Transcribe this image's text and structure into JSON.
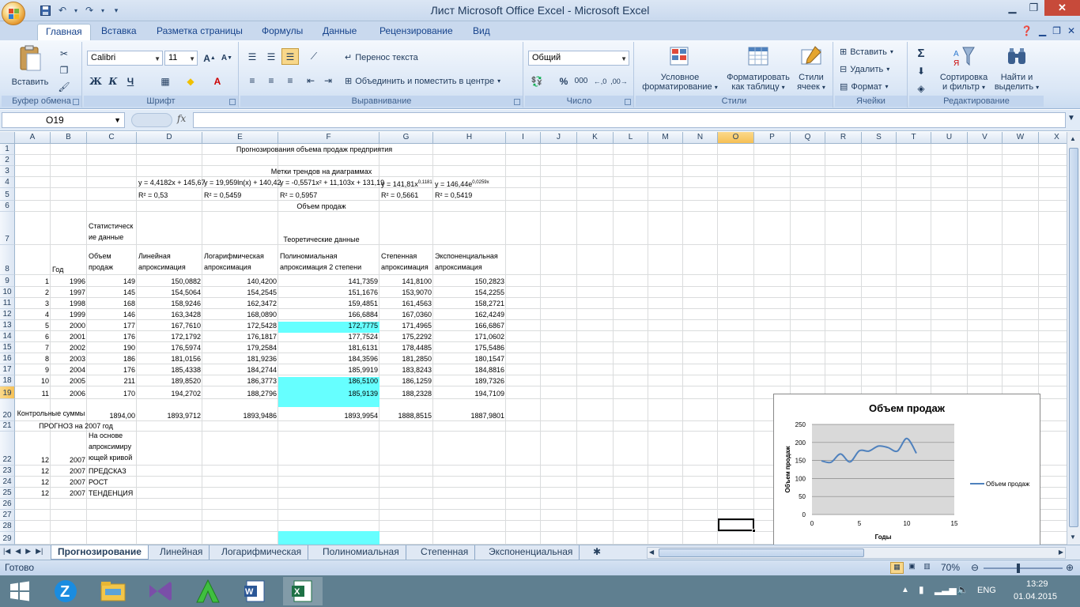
{
  "window": {
    "title": "Лист Microsoft Office Excel - Microsoft Excel",
    "minimize_icon": "minimize-icon",
    "restore_icon": "restore-icon",
    "close_icon": "close-icon"
  },
  "ribbon_tabs": [
    "Главная",
    "Вставка",
    "Разметка страницы",
    "Формулы",
    "Данные",
    "Рецензирование",
    "Вид"
  ],
  "ribbon": {
    "clipboard": {
      "label": "Буфер обмена",
      "paste": "Вставить"
    },
    "font": {
      "label": "Шрифт",
      "name": "Calibri",
      "size": "11",
      "bold": "Ж",
      "italic": "К",
      "underline": "Ч"
    },
    "alignment": {
      "label": "Выравнивание",
      "wrap": "Перенос текста",
      "merge": "Объединить и поместить в центре"
    },
    "number": {
      "label": "Число",
      "format": "Общий",
      "percent": "%",
      "thousands": "000"
    },
    "styles": {
      "label": "Стили",
      "conditional1": "Условное",
      "conditional2": "форматирование",
      "table1": "Форматировать",
      "table2": "как таблицу",
      "cell1": "Стили",
      "cell2": "ячеек"
    },
    "cells": {
      "label": "Ячейки",
      "insert": "Вставить",
      "delete": "Удалить",
      "format": "Формат"
    },
    "editing": {
      "label": "Редактирование",
      "sort1": "Сортировка",
      "sort2": "и фильтр",
      "find1": "Найти и",
      "find2": "выделить",
      "sigma": "Σ"
    }
  },
  "formula_bar": {
    "name_box": "O19",
    "fx": "fx",
    "formula": ""
  },
  "columns": [
    "A",
    "B",
    "C",
    "D",
    "E",
    "F",
    "G",
    "H",
    "I",
    "J",
    "K",
    "L",
    "M",
    "N",
    "O",
    "P",
    "Q",
    "R",
    "S",
    "T",
    "U",
    "V",
    "W",
    "X"
  ],
  "selected_column": "O",
  "rows": [
    "1",
    "2",
    "3",
    "4",
    "5",
    "6",
    "7",
    "8",
    "9",
    "10",
    "11",
    "12",
    "13",
    "14",
    "15",
    "16",
    "17",
    "18",
    "19",
    "20",
    "21",
    "22",
    "23",
    "24",
    "25",
    "26",
    "27",
    "28",
    "29"
  ],
  "selected_row": "19",
  "sheet": {
    "title": "Прогнозирования объема продаж предприятия",
    "trend_title": "Метки трендов на диаграммах",
    "eq_linear": "y = 4,4182x + 145,67",
    "eq_log": "y = 19,959ln(x) + 140,42",
    "eq_poly": "y = -0,5571x² + 11,103x + 131,19",
    "eq_power": "y = 141,81x",
    "eq_power_exp": "0,1181",
    "eq_exp": "y = 146,44e",
    "eq_exp_exp": "0,0259x",
    "r2_linear": "R² = 0,53",
    "r2_log": "R² = 0,5459",
    "r2_poly": "R² = 0,5957",
    "r2_power": "R² = 0,5661",
    "r2_exp": "R² = 0,5419",
    "sales_header": "Объем продаж",
    "stat_header": "Статистическ ие данные",
    "theory_header": "Теоретические данные",
    "h_year": "Год",
    "h_volume": "Объем продаж",
    "h_linear": "Линейная апроксимация",
    "h_log": "Логарифмическая апроксимация",
    "h_poly": "Полиномиальная апроксимация 2 степени",
    "h_power": "Степенная апроксимация",
    "h_exp": "Экспоненциальная апроксимация",
    "data_rows": [
      [
        "1",
        "1996",
        "149",
        "150,0882",
        "140,4200",
        "141,7359",
        "141,8100",
        "150,2823"
      ],
      [
        "2",
        "1997",
        "145",
        "154,5064",
        "154,2545",
        "151,1676",
        "153,9070",
        "154,2255"
      ],
      [
        "3",
        "1998",
        "168",
        "158,9246",
        "162,3472",
        "159,4851",
        "161,4563",
        "158,2721"
      ],
      [
        "4",
        "1999",
        "146",
        "163,3428",
        "168,0890",
        "166,6884",
        "167,0360",
        "162,4249"
      ],
      [
        "5",
        "2000",
        "177",
        "167,7610",
        "172,5428",
        "172,7775",
        "171,4965",
        "166,6867"
      ],
      [
        "6",
        "2001",
        "176",
        "172,1792",
        "176,1817",
        "177,7524",
        "175,2292",
        "171,0602"
      ],
      [
        "7",
        "2002",
        "190",
        "176,5974",
        "179,2584",
        "181,6131",
        "178,4485",
        "175,5486"
      ],
      [
        "8",
        "2003",
        "186",
        "181,0156",
        "181,9236",
        "184,3596",
        "181,2850",
        "180,1547"
      ],
      [
        "9",
        "2004",
        "176",
        "185,4338",
        "184,2744",
        "185,9919",
        "183,8243",
        "184,8816"
      ],
      [
        "10",
        "2005",
        "211",
        "189,8520",
        "186,3773",
        "186,5100",
        "186,1259",
        "189,7326"
      ],
      [
        "11",
        "2006",
        "170",
        "194,2702",
        "188,2796",
        "185,9139",
        "188,2328",
        "194,7109"
      ]
    ],
    "sums_label": "Контрольные суммы",
    "sums": [
      "1894,00",
      "1893,9712",
      "1893,9486",
      "1893,9954",
      "1888,8515",
      "1887,9801"
    ],
    "forecast_label": "ПРОГНОЗ на 2007 год",
    "forecast_rows": [
      [
        "12",
        "2007",
        "На основе апроксимиру ющей кривой"
      ],
      [
        "12",
        "2007",
        "ПРЕДСКАЗ"
      ],
      [
        "12",
        "2007",
        "РОСТ"
      ],
      [
        "12",
        "2007",
        "ТЕНДЕНЦИЯ"
      ]
    ]
  },
  "chart_data": {
    "type": "line",
    "title": "Объем продаж",
    "xlabel": "Годы",
    "ylabel": "Объем продаж",
    "x": [
      1,
      2,
      3,
      4,
      5,
      6,
      7,
      8,
      9,
      10,
      11
    ],
    "series": [
      {
        "name": "Объем продаж",
        "values": [
          149,
          145,
          168,
          146,
          177,
          176,
          190,
          186,
          176,
          211,
          170
        ],
        "color": "#4f81bd"
      }
    ],
    "xlim": [
      0,
      15
    ],
    "ylim": [
      0,
      250
    ],
    "xticks": [
      "0",
      "5",
      "10",
      "15"
    ],
    "yticks": [
      "0",
      "50",
      "100",
      "150",
      "200",
      "250"
    ],
    "grid": true,
    "legend": "right",
    "plot_background": "#d9d9d9"
  },
  "sheet_tabs": [
    "Прогнозирование",
    "Линейная",
    "Логарифмическая",
    "Полиномиальная",
    "Степенная",
    "Экспоненциальная"
  ],
  "status_bar": {
    "ready": "Готово",
    "zoom": "70%"
  },
  "taskbar": {
    "lang": "ENG",
    "time": "13:29",
    "date": "01.04.2015"
  },
  "colors": {
    "highlight": "#66ffff",
    "accent": "#15428b"
  }
}
